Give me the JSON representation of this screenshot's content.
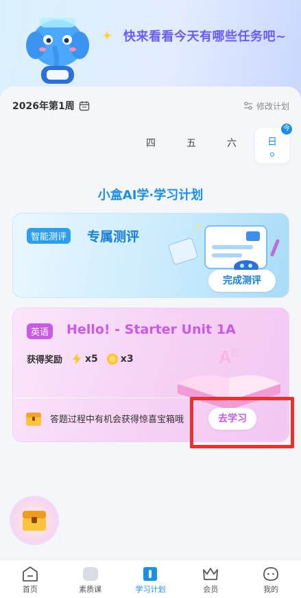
{
  "header": {
    "headline": "快来看看今天有哪些任务吧~",
    "mascot_icon": "mascot-elephant-icon"
  },
  "week": {
    "label": "2026年第1周",
    "edit_label": "修改计划"
  },
  "days": {
    "thu": "四",
    "fri": "五",
    "sat": "六",
    "sun": "日",
    "today_badge": "今"
  },
  "plan": {
    "title": "小盒AI学·学习计划"
  },
  "assessment_card": {
    "tag": "智能测评",
    "title": "专属测评",
    "button": "完成测评"
  },
  "lesson_card": {
    "tag": "英语",
    "title": "Hello! - Starter Unit 1A",
    "reward_label": "获得奖励",
    "lightning_count": "x5",
    "coin_count": "x3",
    "chest_text": "答题过程中有机会获得惊喜宝箱哦",
    "button": "去学习"
  },
  "tabbar": {
    "home": "首页",
    "quality": "素质课",
    "plan": "学习计划",
    "member": "会员",
    "mine": "我的"
  },
  "colors": {
    "accent_blue": "#1a8fe8",
    "accent_purple": "#c95ae3",
    "highlight_red": "#e8322a"
  }
}
